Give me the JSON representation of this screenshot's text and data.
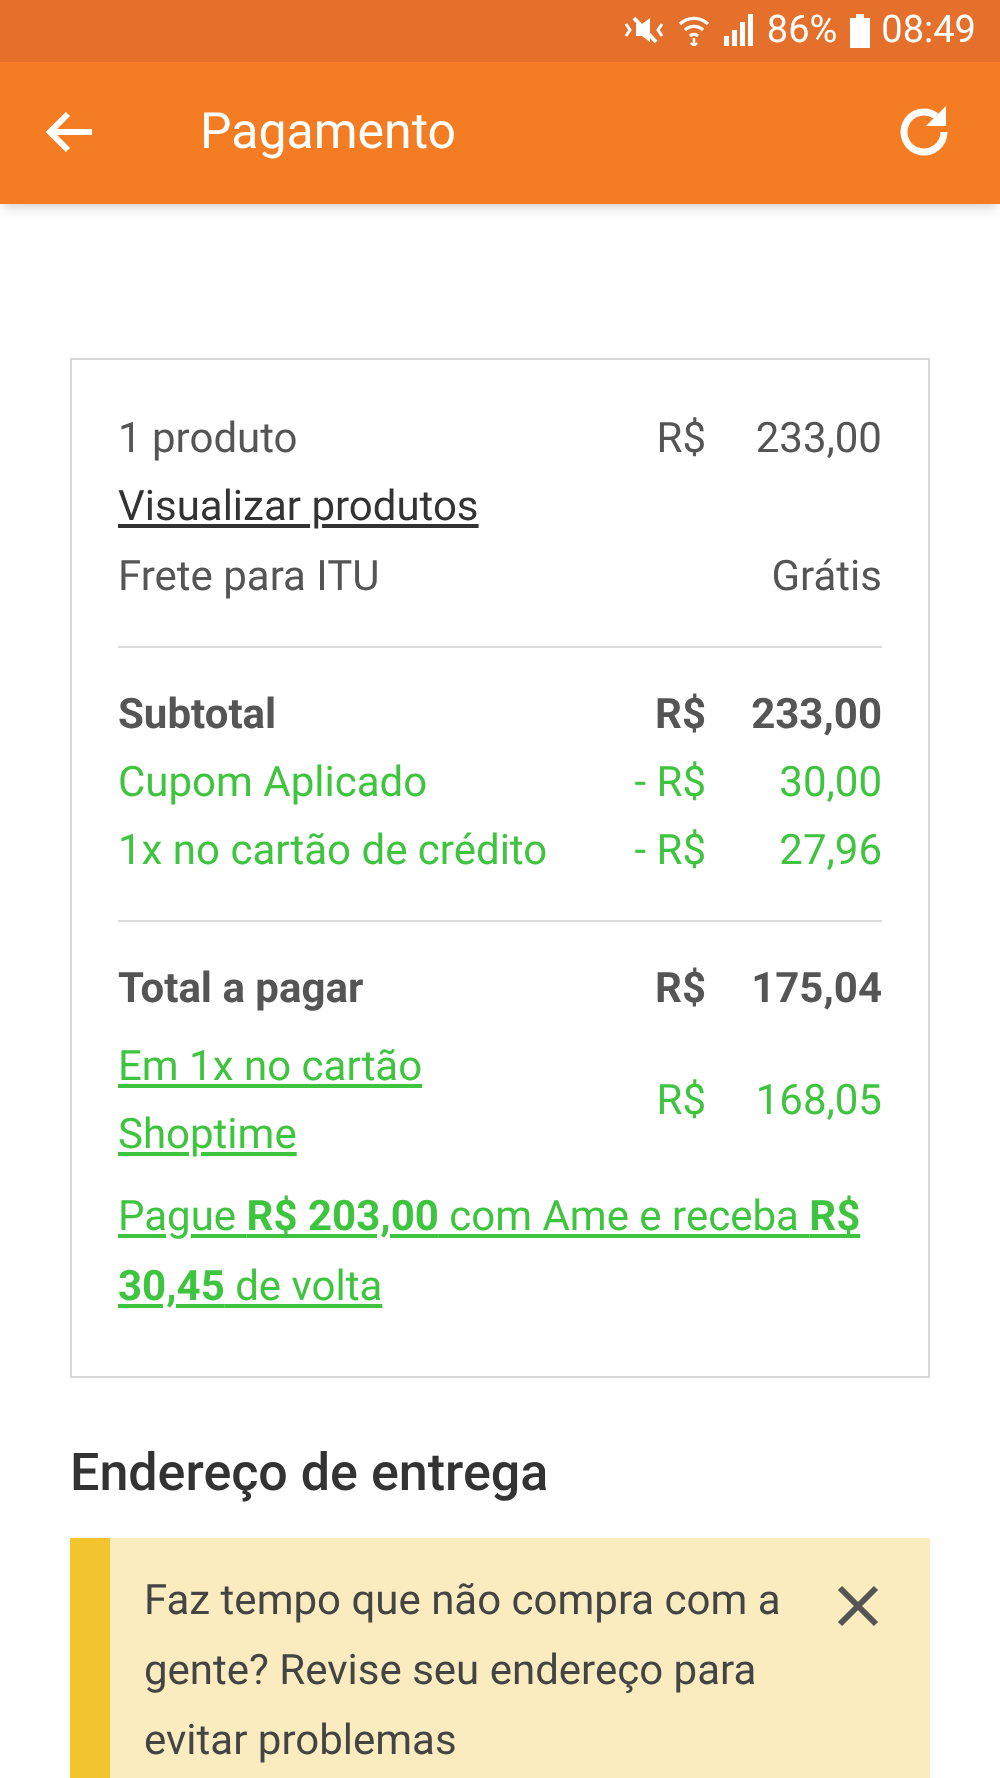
{
  "status_bar": {
    "battery": "86%",
    "time": "08:49"
  },
  "app_bar": {
    "title": "Pagamento"
  },
  "summary": {
    "sections": [
      {
        "rows": [
          {
            "kind": "plain",
            "label": "1 produto",
            "currency": "R$",
            "amount": "233,00"
          },
          {
            "kind": "link",
            "label": "Visualizar produtos"
          },
          {
            "kind": "plain",
            "label": "Frete para ITU",
            "amount": "Grátis"
          }
        ]
      },
      {
        "rows": [
          {
            "kind": "bold",
            "label": "Subtotal",
            "currency": "R$",
            "amount": "233,00"
          },
          {
            "kind": "discount",
            "label": "Cupom Aplicado",
            "currency": "- R$",
            "amount": "30,00"
          },
          {
            "kind": "discount",
            "label": "1x no cartão de crédito",
            "currency": "- R$",
            "amount": "27,96"
          }
        ]
      },
      {
        "rows": [
          {
            "kind": "bold",
            "label": "Total a pagar",
            "currency": "R$",
            "amount": "175,04"
          },
          {
            "kind": "installment",
            "label": "Em 1x no cartão Shoptime",
            "currency": "R$",
            "amount": "168,05"
          },
          {
            "kind": "promo",
            "label": "Pague **R$ 203,00** com Ame e receba **R$ 30,45** de volta"
          }
        ]
      }
    ]
  },
  "address": {
    "heading": "Endereço de entrega",
    "alert": {
      "text": "Faz tempo que não compra com a gente? Revise seu endereço para evitar problemas"
    }
  }
}
